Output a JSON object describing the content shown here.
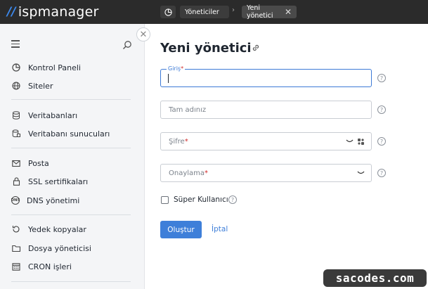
{
  "app": {
    "logo_text": "ispmanager",
    "logo_mark": "//"
  },
  "tabs": [
    {
      "label": "Yöneticiler"
    },
    {
      "label": "Yeni yönetici"
    }
  ],
  "tab_separator": "›",
  "sidebar": {
    "items": [
      {
        "label": "Kontrol Paneli",
        "icon": "dashboard-icon"
      },
      {
        "label": "Siteler",
        "icon": "globe-icon"
      },
      {
        "label": "Veritabanları",
        "icon": "database-icon"
      },
      {
        "label": "Veritabanı sunucuları",
        "icon": "database-server-icon"
      },
      {
        "label": "Posta",
        "icon": "mail-icon"
      },
      {
        "label": "SSL sertifikaları",
        "icon": "lock-icon"
      },
      {
        "label": "DNS yönetimi",
        "icon": "dns-icon"
      },
      {
        "label": "Yedek kopyalar",
        "icon": "backup-icon"
      },
      {
        "label": "Dosya yöneticisi",
        "icon": "folder-icon"
      },
      {
        "label": "CRON işleri",
        "icon": "calendar-icon"
      }
    ],
    "dns_badge": "DNS"
  },
  "form": {
    "title": "Yeni yönetici",
    "login_label": "Giriş",
    "fullname_placeholder": "Tam adınız",
    "password_label": "Şifre",
    "confirm_label": "Onaylama",
    "required_mark": "*",
    "superuser_label": "Süper Kullanıcı",
    "help_glyph": "?",
    "submit_label": "Oluştur",
    "cancel_label": "İptal"
  },
  "watermark": "sacodes.com",
  "colors": {
    "accent": "#3e7fd9",
    "topbar": "#2b2b2b",
    "required": "#d12b2b"
  }
}
